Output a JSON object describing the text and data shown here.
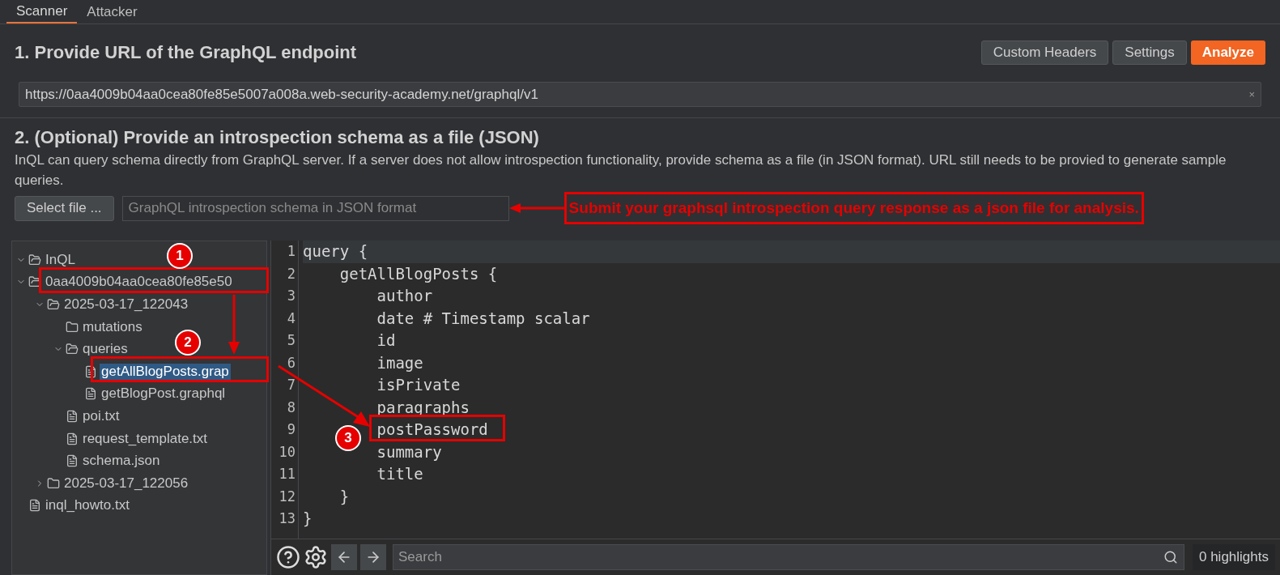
{
  "tabs": [
    {
      "label": "Scanner",
      "selected": true
    },
    {
      "label": "Attacker",
      "selected": false
    }
  ],
  "endpoint": {
    "title": "1. Provide URL of the GraphQL endpoint",
    "buttons": [
      {
        "label": "Custom Headers",
        "kind": "normal"
      },
      {
        "label": "Settings",
        "kind": "normal"
      },
      {
        "label": "Analyze",
        "kind": "primary"
      }
    ],
    "url": "https://0aa4009b04aa0cea80fe85e5007a008a.web-security-academy.net/graphql/v1",
    "clear": "×"
  },
  "schema": {
    "title": "2. (Optional) Provide an introspection schema as a file (JSON)",
    "description": "InQL can query schema directly from GraphQL server. If a server does not allow introspection functionality, provide schema as a file (in JSON format). URL still needs to be provied to generate sample queries.",
    "select_button": "Select file ...",
    "file_field": {
      "placeholder": "GraphQL introspection schema in JSON format"
    },
    "callout": "Submit your graphsql introspection query response as a json file for analysis."
  },
  "tree": [
    {
      "label": "InQL",
      "kind": "folder",
      "expanded": true,
      "selected": false
    },
    {
      "label": "0aa4009b04aa0cea80fe85e50",
      "kind": "folder",
      "expanded": true,
      "selected": false,
      "children": [
        {
          "label": "2025-03-17_122043",
          "kind": "folder",
          "expanded": true,
          "selected": false,
          "children": [
            {
              "label": "mutations",
              "kind": "leaf-folder",
              "selected": false
            },
            {
              "label": "queries",
              "kind": "folder",
              "expanded": true,
              "selected": false,
              "children": [
                {
                  "label": "getAllBlogPosts.grap",
                  "kind": "file",
                  "selected": true
                },
                {
                  "label": "getBlogPost.graphql",
                  "kind": "file",
                  "selected": false
                }
              ]
            },
            {
              "label": "poi.txt",
              "kind": "file",
              "selected": false
            },
            {
              "label": "request_template.txt",
              "kind": "file",
              "selected": false
            },
            {
              "label": "schema.json",
              "kind": "file",
              "selected": false
            }
          ]
        },
        {
          "label": "2025-03-17_122056",
          "kind": "folder",
          "expanded": false,
          "selected": false
        }
      ]
    },
    {
      "label": "inql_howto.txt",
      "kind": "file",
      "selected": false
    }
  ],
  "editor": {
    "lines": [
      {
        "number": "1",
        "text": "query {"
      },
      {
        "number": "2",
        "text": "    getAllBlogPosts {"
      },
      {
        "number": "3",
        "text": "        author"
      },
      {
        "number": "4",
        "text": "        date # Timestamp scalar"
      },
      {
        "number": "5",
        "text": "        id"
      },
      {
        "number": "6",
        "text": "        image"
      },
      {
        "number": "7",
        "text": "        isPrivate"
      },
      {
        "number": "8",
        "text": "        paragraphs"
      },
      {
        "number": "9",
        "text": "        postPassword"
      },
      {
        "number": "10",
        "text": "        summary"
      },
      {
        "number": "11",
        "text": "        title"
      },
      {
        "number": "12",
        "text": "    }"
      },
      {
        "number": "13",
        "text": "}"
      }
    ]
  },
  "search": {
    "placeholder": "Search",
    "highlights": "0 highlights"
  },
  "markers": [
    "1",
    "2",
    "3"
  ]
}
